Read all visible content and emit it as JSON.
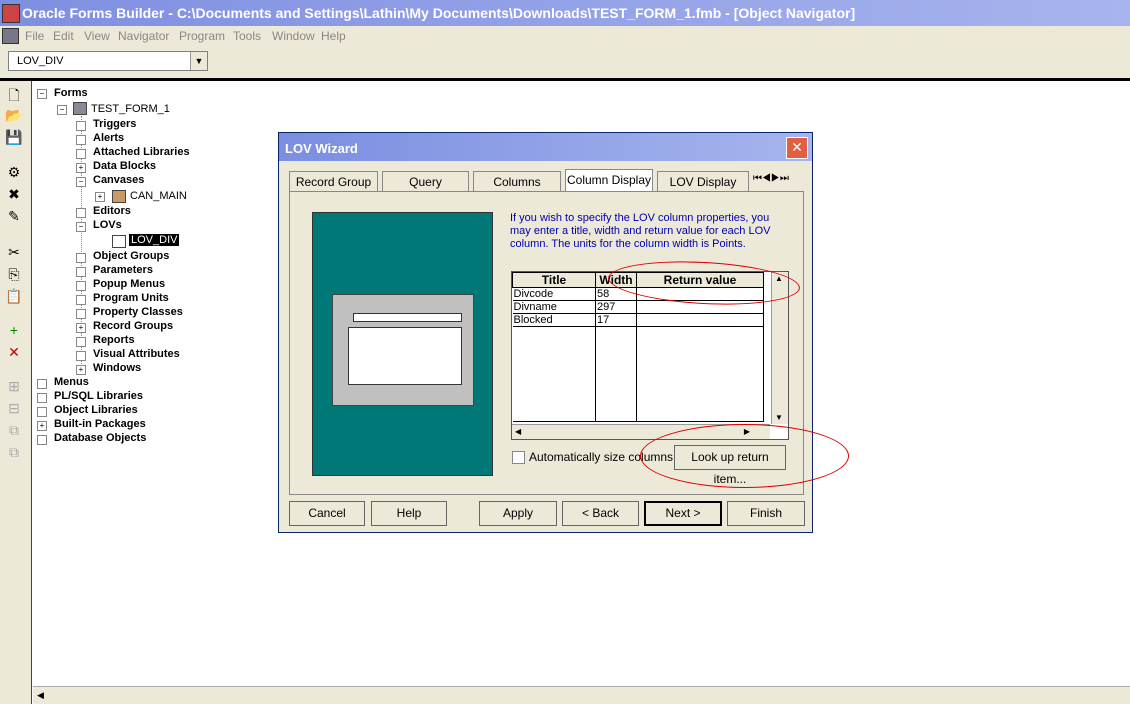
{
  "window": {
    "title": "Oracle Forms Builder - C:\\Documents and Settings\\Lathin\\My Documents\\Downloads\\TEST_FORM_1.fmb - [Object Navigator]"
  },
  "menu": [
    "File",
    "Edit",
    "View",
    "Navigator",
    "Program",
    "Tools",
    "Window",
    "Help"
  ],
  "toolbar": {
    "combo_value": "LOV_DIV"
  },
  "tree": {
    "forms": "Forms",
    "form_name": "TEST_FORM_1",
    "form_children": [
      "Triggers",
      "Alerts",
      "Attached Libraries",
      "Data Blocks",
      "Canvases",
      "Editors",
      "LOVs",
      "Object Groups",
      "Parameters",
      "Popup Menus",
      "Program Units",
      "Property Classes",
      "Record Groups",
      "Reports",
      "Visual Attributes",
      "Windows"
    ],
    "canvas_item": "CAN_MAIN",
    "lov_item": "LOV_DIV",
    "top_level": [
      "Menus",
      "PL/SQL Libraries",
      "Object Libraries",
      "Built-in Packages",
      "Database Objects"
    ]
  },
  "dialog": {
    "title": "LOV Wizard",
    "tabs": [
      "Record Group",
      "Query",
      "Columns",
      "Column Display",
      "LOV Display"
    ],
    "active_tab": "Column Display",
    "instructions": "If you wish to specify the LOV column properties, you may enter a title, width and return value for each LOV column.  The units for the column width is Points.",
    "grid": {
      "headers": [
        "Title",
        "Width",
        "Return value"
      ],
      "rows": [
        {
          "title": "Divcode",
          "width": "58",
          "return": ""
        },
        {
          "title": "Divname",
          "width": "297",
          "return": ""
        },
        {
          "title": "Blocked",
          "width": "17",
          "return": ""
        }
      ]
    },
    "autosize_label": "Automatically size columns",
    "lookup_button": "Look up return item...",
    "buttons": {
      "cancel": "Cancel",
      "help": "Help",
      "apply": "Apply",
      "back": "< Back",
      "next": "Next >",
      "finish": "Finish"
    }
  },
  "colors": {
    "titlebar": "#7f8fe0",
    "preview_bg": "#007878",
    "annotation": "#dd0000"
  }
}
